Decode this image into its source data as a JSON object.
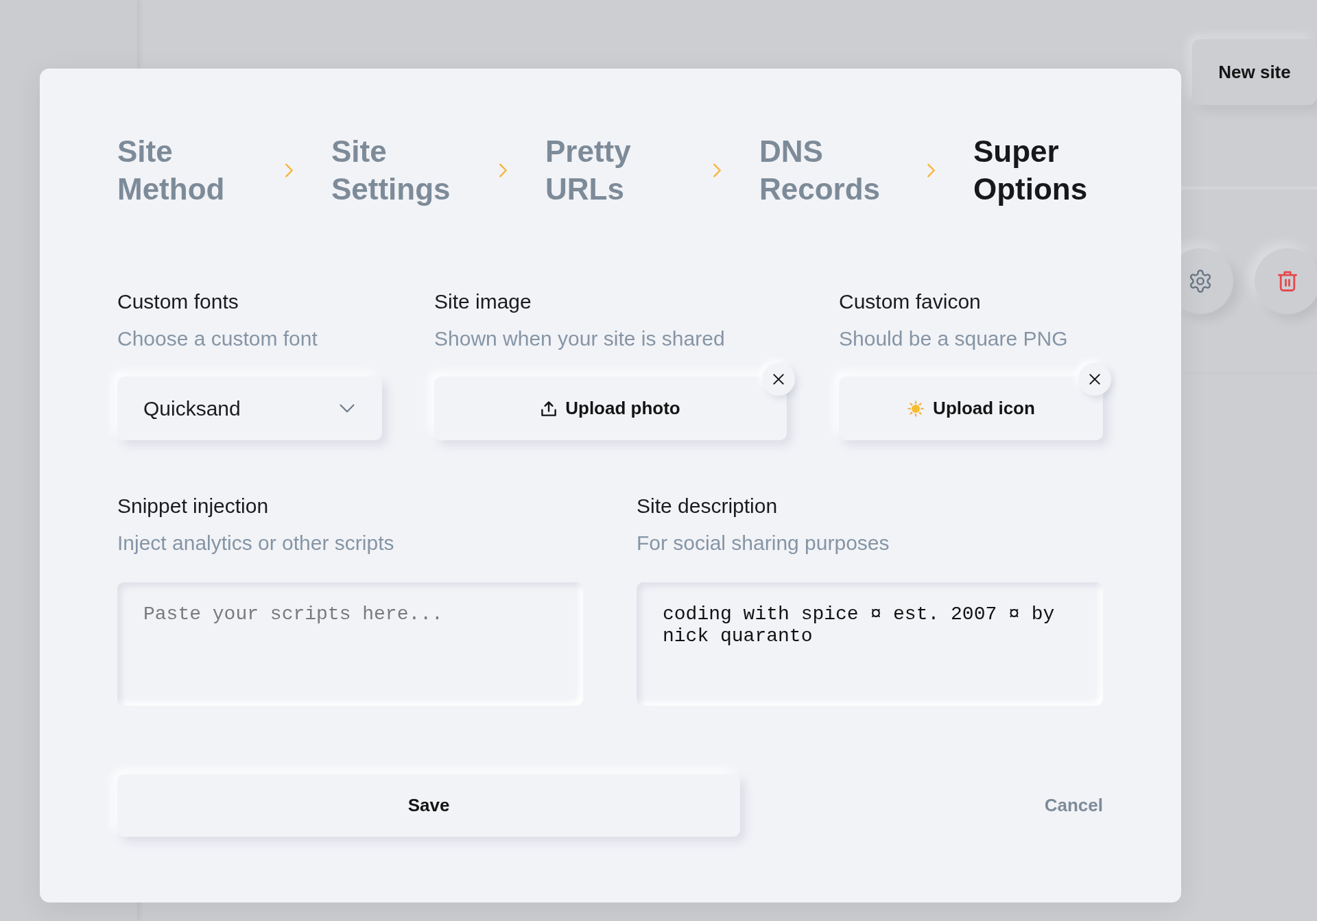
{
  "background": {
    "new_site_button": "New site"
  },
  "modal": {
    "steps": [
      {
        "label": "Site Method",
        "selected": false
      },
      {
        "label": "Site Settings",
        "selected": false
      },
      {
        "label": "Pretty URLs",
        "selected": false
      },
      {
        "label": "DNS Records",
        "selected": false
      },
      {
        "label": "Super Options",
        "selected": true
      }
    ],
    "rows": [
      {
        "fields": [
          {
            "kind": "select",
            "label": "Custom fonts",
            "hint": "Choose a custom font",
            "value": "Quicksand"
          },
          {
            "kind": "image_upload",
            "label": "Site image",
            "hint": "Shown when your site is shared",
            "button": "Upload photo",
            "removable": true
          },
          {
            "kind": "favicon_upload",
            "label": "Custom favicon",
            "hint": "Should be a square PNG",
            "button": "Upload icon",
            "removable": true
          }
        ]
      },
      {
        "fields": [
          {
            "kind": "textarea",
            "label": "Snippet injection",
            "hint": "Inject analytics or other scripts",
            "placeholder": "Paste your scripts here..."
          },
          {
            "kind": "textarea",
            "label": "Site description",
            "hint": "For social sharing purposes",
            "value": "coding with spice ¤ est. 2007 ¤ by nick quaranto"
          }
        ]
      }
    ],
    "buttons": [
      {
        "kind": "primary",
        "label": "Save"
      },
      {
        "kind": "link",
        "label": "Cancel"
      }
    ]
  }
}
